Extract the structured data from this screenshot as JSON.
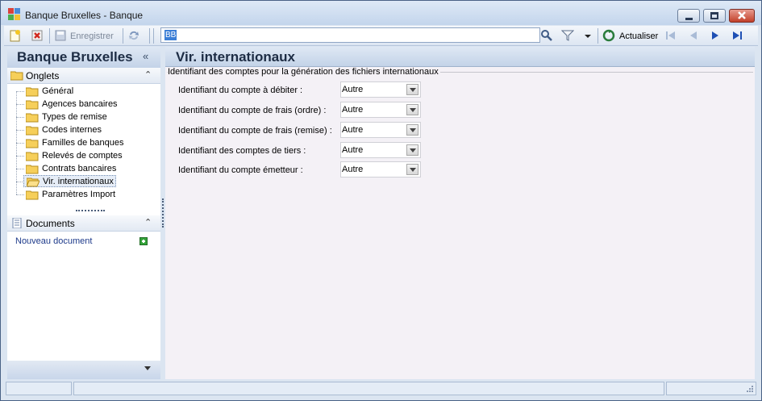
{
  "window": {
    "title": "Banque Bruxelles -  Banque"
  },
  "toolbar": {
    "save_label": "Enregistrer",
    "search_value": "BB",
    "refresh_label": "Actualiser"
  },
  "sidebar": {
    "title": "Banque Bruxelles",
    "collapse_glyph": "«",
    "onglets_label": "Onglets",
    "items": [
      {
        "label": "Général"
      },
      {
        "label": "Agences bancaires"
      },
      {
        "label": "Types de remise"
      },
      {
        "label": "Codes internes"
      },
      {
        "label": "Familles de banques"
      },
      {
        "label": "Relevés de comptes"
      },
      {
        "label": "Contrats bancaires"
      },
      {
        "label": "Vir. internationaux",
        "selected": true
      },
      {
        "label": "Paramètres Import"
      }
    ],
    "documents_label": "Documents",
    "new_document_label": "Nouveau document"
  },
  "main": {
    "title": "Vir. internationaux",
    "group_title": "Identifiant des comptes pour la génération des fichiers internationaux",
    "fields": [
      {
        "label": "Identifiant du compte à débiter :",
        "value": "Autre"
      },
      {
        "label": "Identifiant du compte de frais (ordre) :",
        "value": "Autre"
      },
      {
        "label": "Identifiant du compte de frais (remise) :",
        "value": "Autre"
      },
      {
        "label": "Identifiant des comptes de tiers :",
        "value": "Autre"
      },
      {
        "label": "Identifiant du compte émetteur :",
        "value": "Autre"
      }
    ]
  },
  "colors": {
    "accent": "#3b7ed6",
    "header_gradient_top": "#dfe8f4",
    "header_gradient_bottom": "#c3d3e8",
    "content_bg": "#f4f1f6"
  }
}
